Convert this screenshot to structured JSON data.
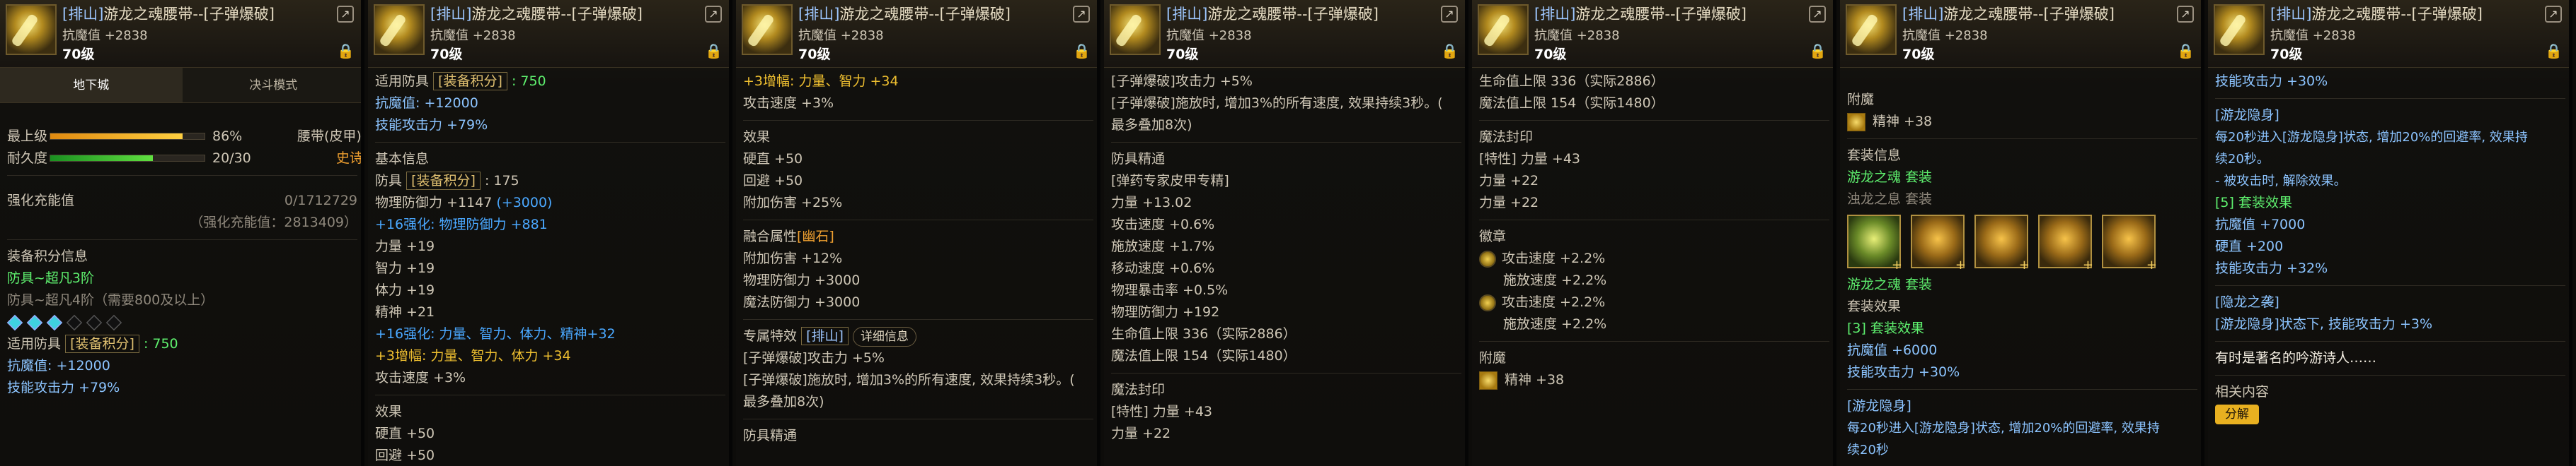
{
  "item": {
    "title_tag": "[排山]",
    "title_name": "游龙之魂腰带--[子弹爆破]",
    "magic_resist": "抗魔值 +2838",
    "level": "70级"
  },
  "p0": {
    "tab_dungeon": "地下城",
    "tab_duel": "决斗模式",
    "max_level_label": "最上级",
    "max_level_value": "86%",
    "max_level_pct": 0.86,
    "durability_label": "耐久度",
    "durability_value": "20/30",
    "durability_pct": 0.667,
    "slot_type": "腰带(皮甲)",
    "rarity": "史诗",
    "reinforce_label": "强化充能值",
    "reinforce_value": "0/1712729",
    "reinforce_sub": "（强化充能值：2813409）",
    "score_info": "装备积分信息",
    "score_tier": "防具~超凡3阶",
    "score_tier_next": "防具~超凡4阶（需要800及以上）",
    "gems_on": 3,
    "gems_total": 6,
    "applicable": "适用防具",
    "score_box": "[装备积分]",
    "score_value": ": 750",
    "resist_line": "抗魔值: +12000",
    "skill_atk": "技能攻击力 +79%"
  },
  "p1": {
    "applicable": "适用防具",
    "score_box": "[装备积分]",
    "score_value": ": 750",
    "resist_line": "抗魔值: +12000",
    "skill_atk": "技能攻击力 +79%",
    "basic_info": "基本信息",
    "armor": "防具",
    "armor_box": "[装备积分]",
    "armor_value": ": 175",
    "phys_def": "物理防御力 +1147",
    "phys_def_bonus": " (+3000)",
    "reinforce": "+16强化:  物理防御力 +881",
    "str": "力量 +19",
    "int": "智力 +19",
    "vit": "体力 +19",
    "spr": "精神 +21",
    "reinforce2": "+16强化:  力量、智力、体力、精神+32",
    "amp": "+3增幅:  力量、智力、体力 +34",
    "atk_speed": "攻击速度 +3%",
    "effect": "效果",
    "hard": "硬直 +50",
    "recovery": "回避 +50"
  },
  "p2": {
    "amp": "+3增幅:  力量、智力 +34",
    "atk_speed": "攻击速度 +3%",
    "effect": "效果",
    "hard": "硬直 +50",
    "recovery": "回避 +50",
    "extra_dmg": "附加伤害 +25%",
    "fusion": "融合属性",
    "fusion_tag": "[幽石]",
    "f_extra": "附加伤害 +12%",
    "f_phys": "物理防御力 +3000",
    "f_magic": "魔法防御力 +3000",
    "special": "专属特效",
    "special_tag": "[排山]",
    "detail": "详细信息",
    "sp1": "[子弹爆破]攻击力 +5%",
    "sp2": "[子弹爆破]施放时, 增加3%的所有速度, 效果持续3秒。(",
    "sp3": "最多叠加8次)",
    "mastery": "防具精通"
  },
  "p3": {
    "sp1": "[子弹爆破]攻击力 +5%",
    "sp2": "[子弹爆破]施放时, 增加3%的所有速度, 效果持续3秒。(",
    "sp3": "最多叠加8次)",
    "mastery": "防具精通",
    "mastery_sub": "[弹药专家皮甲专精]",
    "m_str": "力量 +13.02",
    "m_atk": "攻击速度 +0.6%",
    "m_cast": "施放速度 +1.7%",
    "m_move": "移动速度 +0.6%",
    "m_crit": "物理暴击率 +0.5%",
    "m_pdef": "物理防御力 +192",
    "m_hp": "生命值上限 336（实际2886）",
    "m_mp": "魔法值上限 154（实际1480）",
    "seal": "魔法封印",
    "seal_line": "[特性] 力量 +43",
    "seal_str": "力量 +22"
  },
  "p4": {
    "hp": "生命值上限 336（实际2886）",
    "mp": "魔法值上限 154（实际1480）",
    "seal": "魔法封印",
    "seal_line": "[特性] 力量 +43",
    "seal_str1": "力量 +22",
    "seal_str2": "力量 +22",
    "emblem": "徽章",
    "e1a": "攻击速度 +2.2%",
    "e1b": "施放速度 +2.2%",
    "e2a": "攻击速度 +2.2%",
    "e2b": "施放速度 +2.2%",
    "enchant": "附魔",
    "enchant_val": "精神 +38"
  },
  "p5": {
    "enchant": "附魔",
    "enchant_val": "精神 +38",
    "set_info": "套装信息",
    "set_name": "游龙之魂 套装",
    "set_name2": "浊龙之息 套装",
    "set_caption": "游龙之魂 套装",
    "set_effect": "套装效果",
    "set3": "[3] 套装效果",
    "resist": "抗魔值 +6000",
    "skill": "技能攻击力 +30%",
    "stealth": "[游龙隐身]",
    "stealth_desc1": "每20秒进入[游龙隐身]状态, 增加20%的回避率, 效果持",
    "stealth_desc2": "续20秒"
  },
  "p6": {
    "top_line": "技能攻击力 +30%",
    "stealth": "[游龙隐身]",
    "desc1": "每20秒进入[游龙隐身]状态, 增加20%的回避率, 效果持",
    "desc2": "续20秒。",
    "desc3": "- 被攻击时, 解除效果。",
    "set5": "[5] 套装效果",
    "resist": "抗魔值 +7000",
    "hard": "硬直 +200",
    "skill": "技能攻击力 +32%",
    "hide_title": "[隐龙之袭]",
    "hide_desc": "[游龙隐身]状态下, 技能攻击力 +3%",
    "flavor": "有时是著名的吟游诗人……",
    "related": "相关内容",
    "btn": "分解"
  }
}
